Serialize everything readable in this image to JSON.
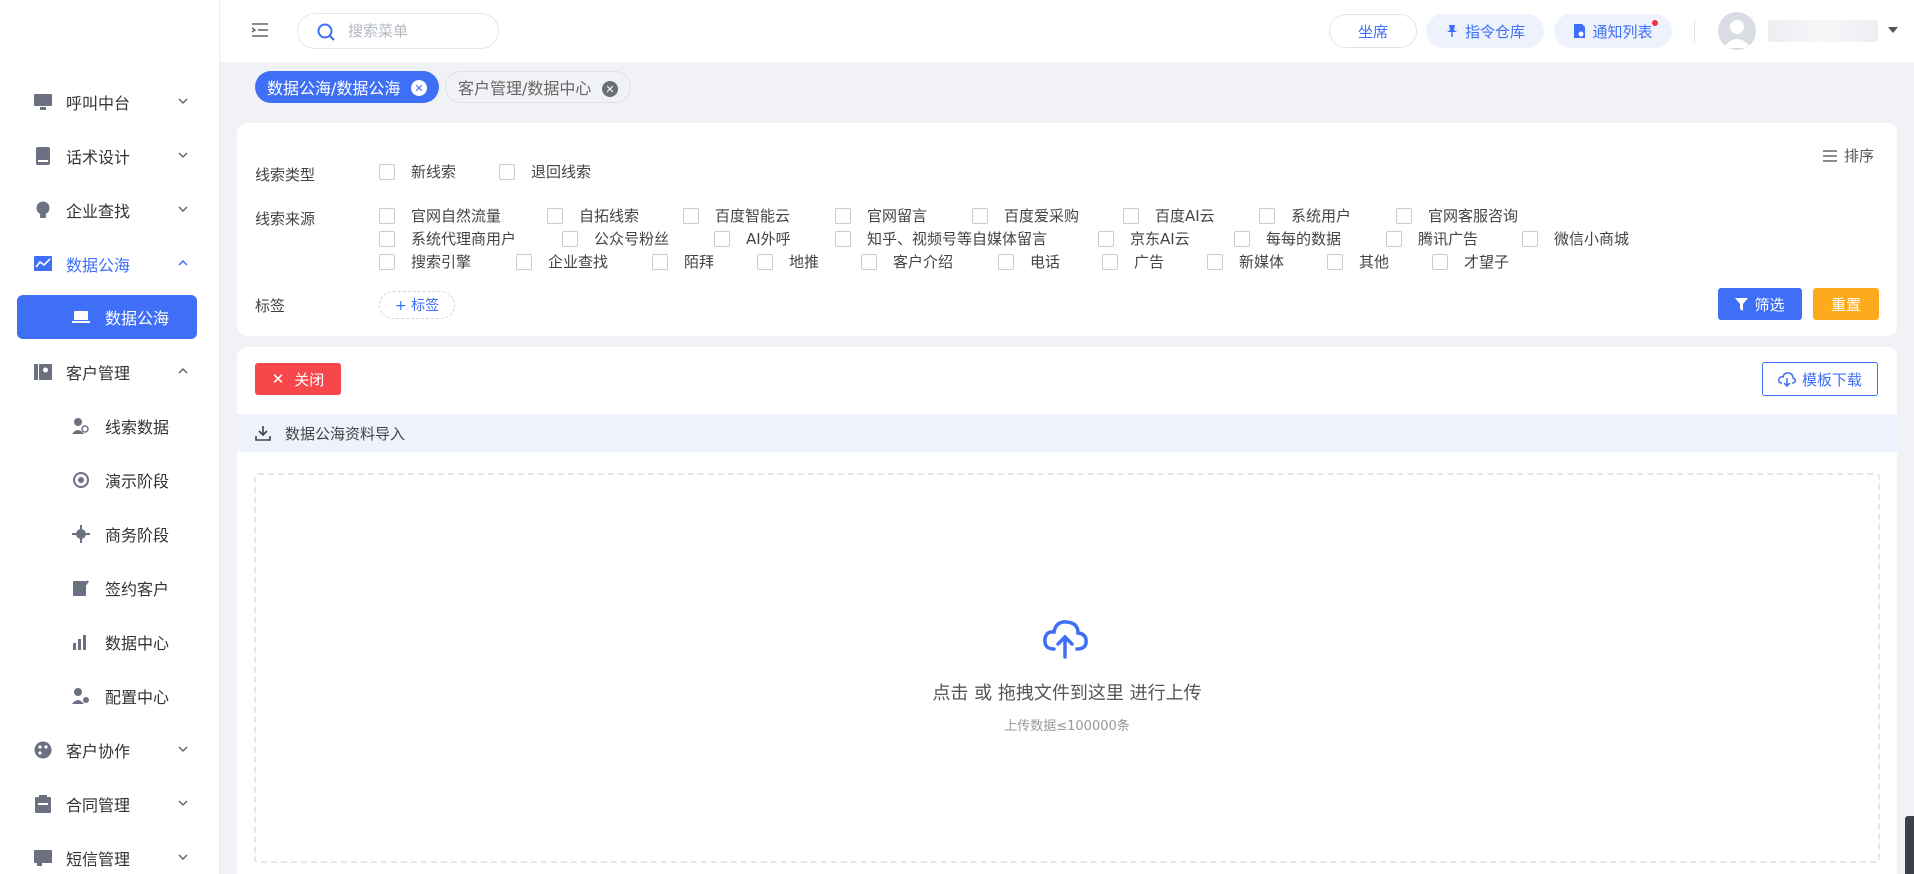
{
  "sidebar": {
    "items": [
      {
        "label": "呼叫中台",
        "icon": "monitor-icon"
      },
      {
        "label": "话术设计",
        "icon": "book-icon"
      },
      {
        "label": "企业查找",
        "icon": "lightbulb-icon"
      },
      {
        "label": "数据公海",
        "icon": "chart-icon"
      },
      {
        "label": "数据公海",
        "icon": "laptop-icon"
      },
      {
        "label": "客户管理",
        "icon": "contacts-icon"
      },
      {
        "label": "线索数据",
        "icon": "user-search-icon"
      },
      {
        "label": "演示阶段",
        "icon": "target-icon"
      },
      {
        "label": "商务阶段",
        "icon": "crosshair-icon"
      },
      {
        "label": "签约客户",
        "icon": "sign-icon"
      },
      {
        "label": "数据中心",
        "icon": "bar-chart-icon"
      },
      {
        "label": "配置中心",
        "icon": "user-gear-icon"
      },
      {
        "label": "客户协作",
        "icon": "palette-icon"
      },
      {
        "label": "合同管理",
        "icon": "clipboard-icon"
      },
      {
        "label": "短信管理",
        "icon": "message-icon"
      }
    ]
  },
  "header": {
    "search_placeholder": "搜索菜单",
    "seat_label": "坐席",
    "command_label": "指令仓库",
    "notice_label": "通知列表"
  },
  "tabs": [
    {
      "label": "数据公海/数据公海",
      "active": true
    },
    {
      "label": "客户管理/数据中心",
      "active": false
    }
  ],
  "filters": {
    "sort_label": "排序",
    "lead_type_label": "线索类型",
    "lead_types": [
      "新线索",
      "退回线索"
    ],
    "lead_source_label": "线索来源",
    "lead_sources_row1": [
      "官网自然流量",
      "自拓线索",
      "百度智能云",
      "官网留言",
      "百度爱采购",
      "百度AI云",
      "系统用户",
      "官网客服咨询"
    ],
    "lead_sources_row2": [
      "系统代理商用户",
      "公众号粉丝",
      "AI外呼",
      "知乎、视频号等自媒体留言",
      "京东AI云",
      "每每的数据",
      "腾讯广告",
      "微信小商城"
    ],
    "lead_sources_row3": [
      "搜索引擎",
      "企业查找",
      "陌拜",
      "地推",
      "客户介绍",
      "电话",
      "广告",
      "新媒体",
      "其他",
      "才望子"
    ],
    "tag_label": "标签",
    "add_tag_label": "+ 标签",
    "filter_button": "筛选",
    "reset_button": "重置"
  },
  "import": {
    "close_button": "关闭",
    "template_button": "模板下载",
    "section_title": "数据公海资料导入",
    "upload_text": "点击 或 拖拽文件到这里 进行上传",
    "upload_limit": "上传数据≤100000条"
  },
  "colors": {
    "primary": "#3e6ff6",
    "danger": "#f6484b",
    "warning": "#fdab1d"
  }
}
